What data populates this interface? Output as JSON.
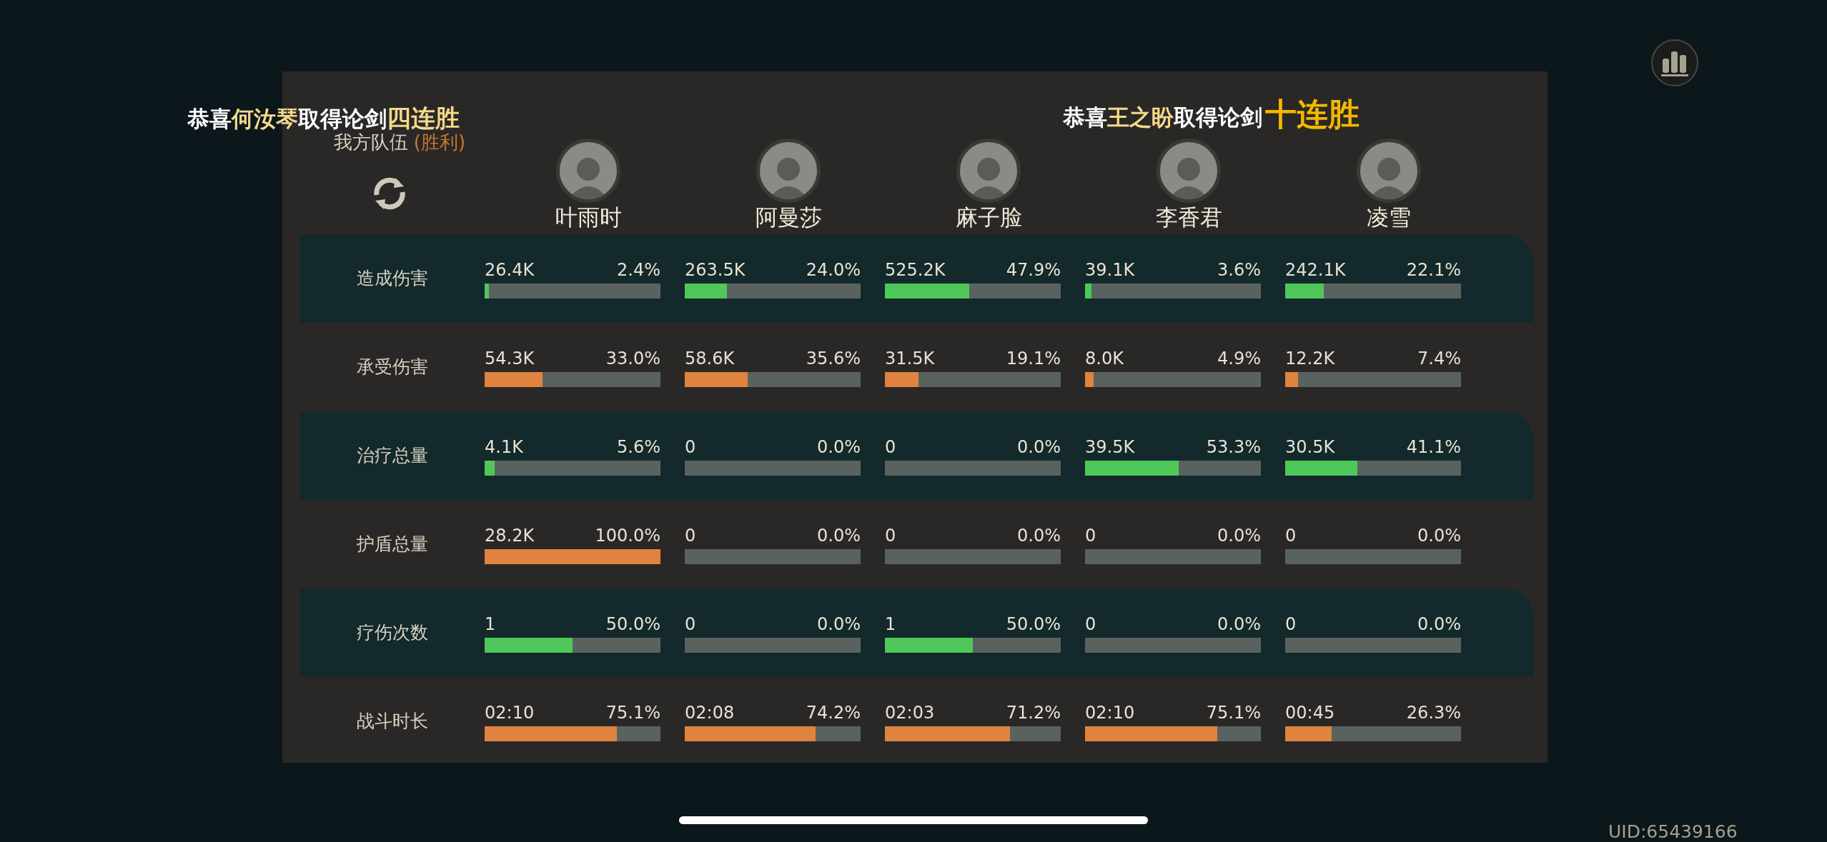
{
  "banners": [
    {
      "prefix": "恭喜",
      "name": "何汝琴",
      "middle": "取得论剑",
      "streak": "四连胜"
    },
    {
      "prefix": "恭喜",
      "name": "王之盼",
      "middle": "取得论剑",
      "streak": "十连胜"
    }
  ],
  "team": {
    "label": "我方队伍",
    "result": "(胜利)"
  },
  "players": [
    {
      "name": "叶雨时"
    },
    {
      "name": "阿曼莎"
    },
    {
      "name": "麻子脸"
    },
    {
      "name": "李香君"
    },
    {
      "name": "凌雪"
    }
  ],
  "stats": [
    {
      "label": "造成伤害",
      "highlighted": true,
      "color": "#4fc85a",
      "cells": [
        {
          "value": "26.4K",
          "percent": "2.4%",
          "level": 0.024
        },
        {
          "value": "263.5K",
          "percent": "24.0%",
          "level": 0.24
        },
        {
          "value": "525.2K",
          "percent": "47.9%",
          "level": 0.479
        },
        {
          "value": "39.1K",
          "percent": "3.6%",
          "level": 0.036
        },
        {
          "value": "242.1K",
          "percent": "22.1%",
          "level": 0.221
        }
      ]
    },
    {
      "label": "承受伤害",
      "highlighted": false,
      "color": "#e0833e",
      "cells": [
        {
          "value": "54.3K",
          "percent": "33.0%",
          "level": 0.33
        },
        {
          "value": "58.6K",
          "percent": "35.6%",
          "level": 0.356
        },
        {
          "value": "31.5K",
          "percent": "19.1%",
          "level": 0.191
        },
        {
          "value": "8.0K",
          "percent": "4.9%",
          "level": 0.049
        },
        {
          "value": "12.2K",
          "percent": "7.4%",
          "level": 0.074
        }
      ]
    },
    {
      "label": "治疗总量",
      "highlighted": true,
      "color": "#4fc85a",
      "cells": [
        {
          "value": "4.1K",
          "percent": "5.6%",
          "level": 0.056
        },
        {
          "value": "0",
          "percent": "0.0%",
          "level": 0
        },
        {
          "value": "0",
          "percent": "0.0%",
          "level": 0
        },
        {
          "value": "39.5K",
          "percent": "53.3%",
          "level": 0.533
        },
        {
          "value": "30.5K",
          "percent": "41.1%",
          "level": 0.411
        }
      ]
    },
    {
      "label": "护盾总量",
      "highlighted": false,
      "color": "#e0833e",
      "cells": [
        {
          "value": "28.2K",
          "percent": "100.0%",
          "level": 1
        },
        {
          "value": "0",
          "percent": "0.0%",
          "level": 0
        },
        {
          "value": "0",
          "percent": "0.0%",
          "level": 0
        },
        {
          "value": "0",
          "percent": "0.0%",
          "level": 0
        },
        {
          "value": "0",
          "percent": "0.0%",
          "level": 0
        }
      ]
    },
    {
      "label": "疗伤次数",
      "highlighted": true,
      "color": "#4fc85a",
      "cells": [
        {
          "value": "1",
          "percent": "50.0%",
          "level": 0.5
        },
        {
          "value": "0",
          "percent": "0.0%",
          "level": 0
        },
        {
          "value": "1",
          "percent": "50.0%",
          "level": 0.5
        },
        {
          "value": "0",
          "percent": "0.0%",
          "level": 0
        },
        {
          "value": "0",
          "percent": "0.0%",
          "level": 0
        }
      ]
    },
    {
      "label": "战斗时长",
      "highlighted": false,
      "color": "#e0833e",
      "cells": [
        {
          "value": "02:10",
          "percent": "75.1%",
          "level": 0.751
        },
        {
          "value": "02:08",
          "percent": "74.2%",
          "level": 0.742
        },
        {
          "value": "02:03",
          "percent": "71.2%",
          "level": 0.712
        },
        {
          "value": "02:10",
          "percent": "75.1%",
          "level": 0.751
        },
        {
          "value": "00:45",
          "percent": "26.3%",
          "level": 0.263
        }
      ]
    }
  ],
  "uid": "UID:65439166"
}
